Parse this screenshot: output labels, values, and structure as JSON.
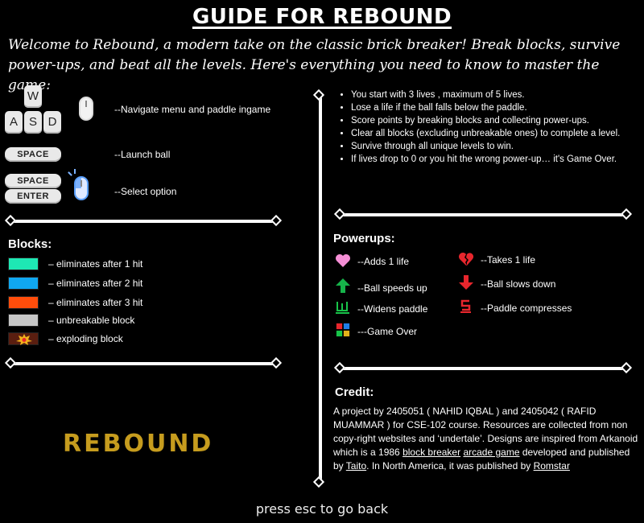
{
  "title": "GUIDE FOR REBOUND",
  "intro": "Welcome to Rebound, a modern take on the classic brick breaker! Break blocks, survive power-ups, and beat all the levels. Here's everything you need to know to master the game:",
  "controls": {
    "keys": {
      "w": "W",
      "a": "A",
      "s": "S",
      "d": "D"
    },
    "space": "SPACE",
    "enter": "ENTER",
    "navigate_label": "--Navigate menu and paddle ingame",
    "launch_label": "--Launch ball",
    "select_label": "--Select option"
  },
  "blocks": {
    "title": "Blocks:",
    "items": [
      {
        "label": "– eliminates after 1 hit",
        "color": "#1ee8b4"
      },
      {
        "label": "– eliminates after 2 hit",
        "color": "#10a7f0"
      },
      {
        "label": "– eliminates after 3 hit",
        "color": "#ff4d0b"
      },
      {
        "label": "– unbreakable block",
        "color": "#c6c6c6"
      },
      {
        "label": "– exploding block",
        "color": "#5a1e10"
      }
    ]
  },
  "rules": [
    "You start with 3 lives , maximum of 5 lives.",
    "Lose a life if the ball falls below the paddle.",
    "Score points by breaking blocks and collecting power-ups.",
    "Clear all blocks (excluding unbreakable ones) to complete a level.",
    "Survive through all unique levels to win.",
    "If lives drop to 0 or you hit the wrong power-up… it's Game Over."
  ],
  "powerups": {
    "title": "Powerups:",
    "items": [
      {
        "icon": "heart-icon",
        "label": "--Adds 1 life",
        "color": "#f58fd6"
      },
      {
        "icon": "broken-heart-icon",
        "label": "--Takes 1 life",
        "color": "#e8262d"
      },
      {
        "icon": "arrow-up-icon",
        "label": "--Ball speeds up",
        "color": "#16b34a"
      },
      {
        "icon": "arrow-down-icon",
        "label": "--Ball slows down",
        "color": "#e8262d"
      },
      {
        "icon": "widen-icon",
        "label": "--Widens paddle",
        "color": "#18c449"
      },
      {
        "icon": "compress-icon",
        "label": "--Paddle  compresses",
        "color": "#e8262d"
      },
      {
        "icon": "game-over-icon",
        "label": "---Game Over",
        "color": "#e2b21a"
      }
    ]
  },
  "credit": {
    "title": "Credit:",
    "text_1": "A project by 2405051 ( NAHID IQBAL ) and 2405042 ( RAFID MUAMMAR ) for CSE-102 course. Resources are collected from non copy-right websites and ‘undertale’. Designs are inspired from Arkanoid which is a 1986 ",
    "link_1": "block breaker",
    "link_2": "arcade game",
    "text_2": " developed and published by ",
    "link_3": "Taito",
    "text_3": ". In North America, it was published by ",
    "link_4": "Romstar"
  },
  "logo": "REBOUND",
  "footer": "press esc to go back",
  "colors": {
    "background": "#000000",
    "text": "#ffffff",
    "logo": "#c69c1e"
  }
}
